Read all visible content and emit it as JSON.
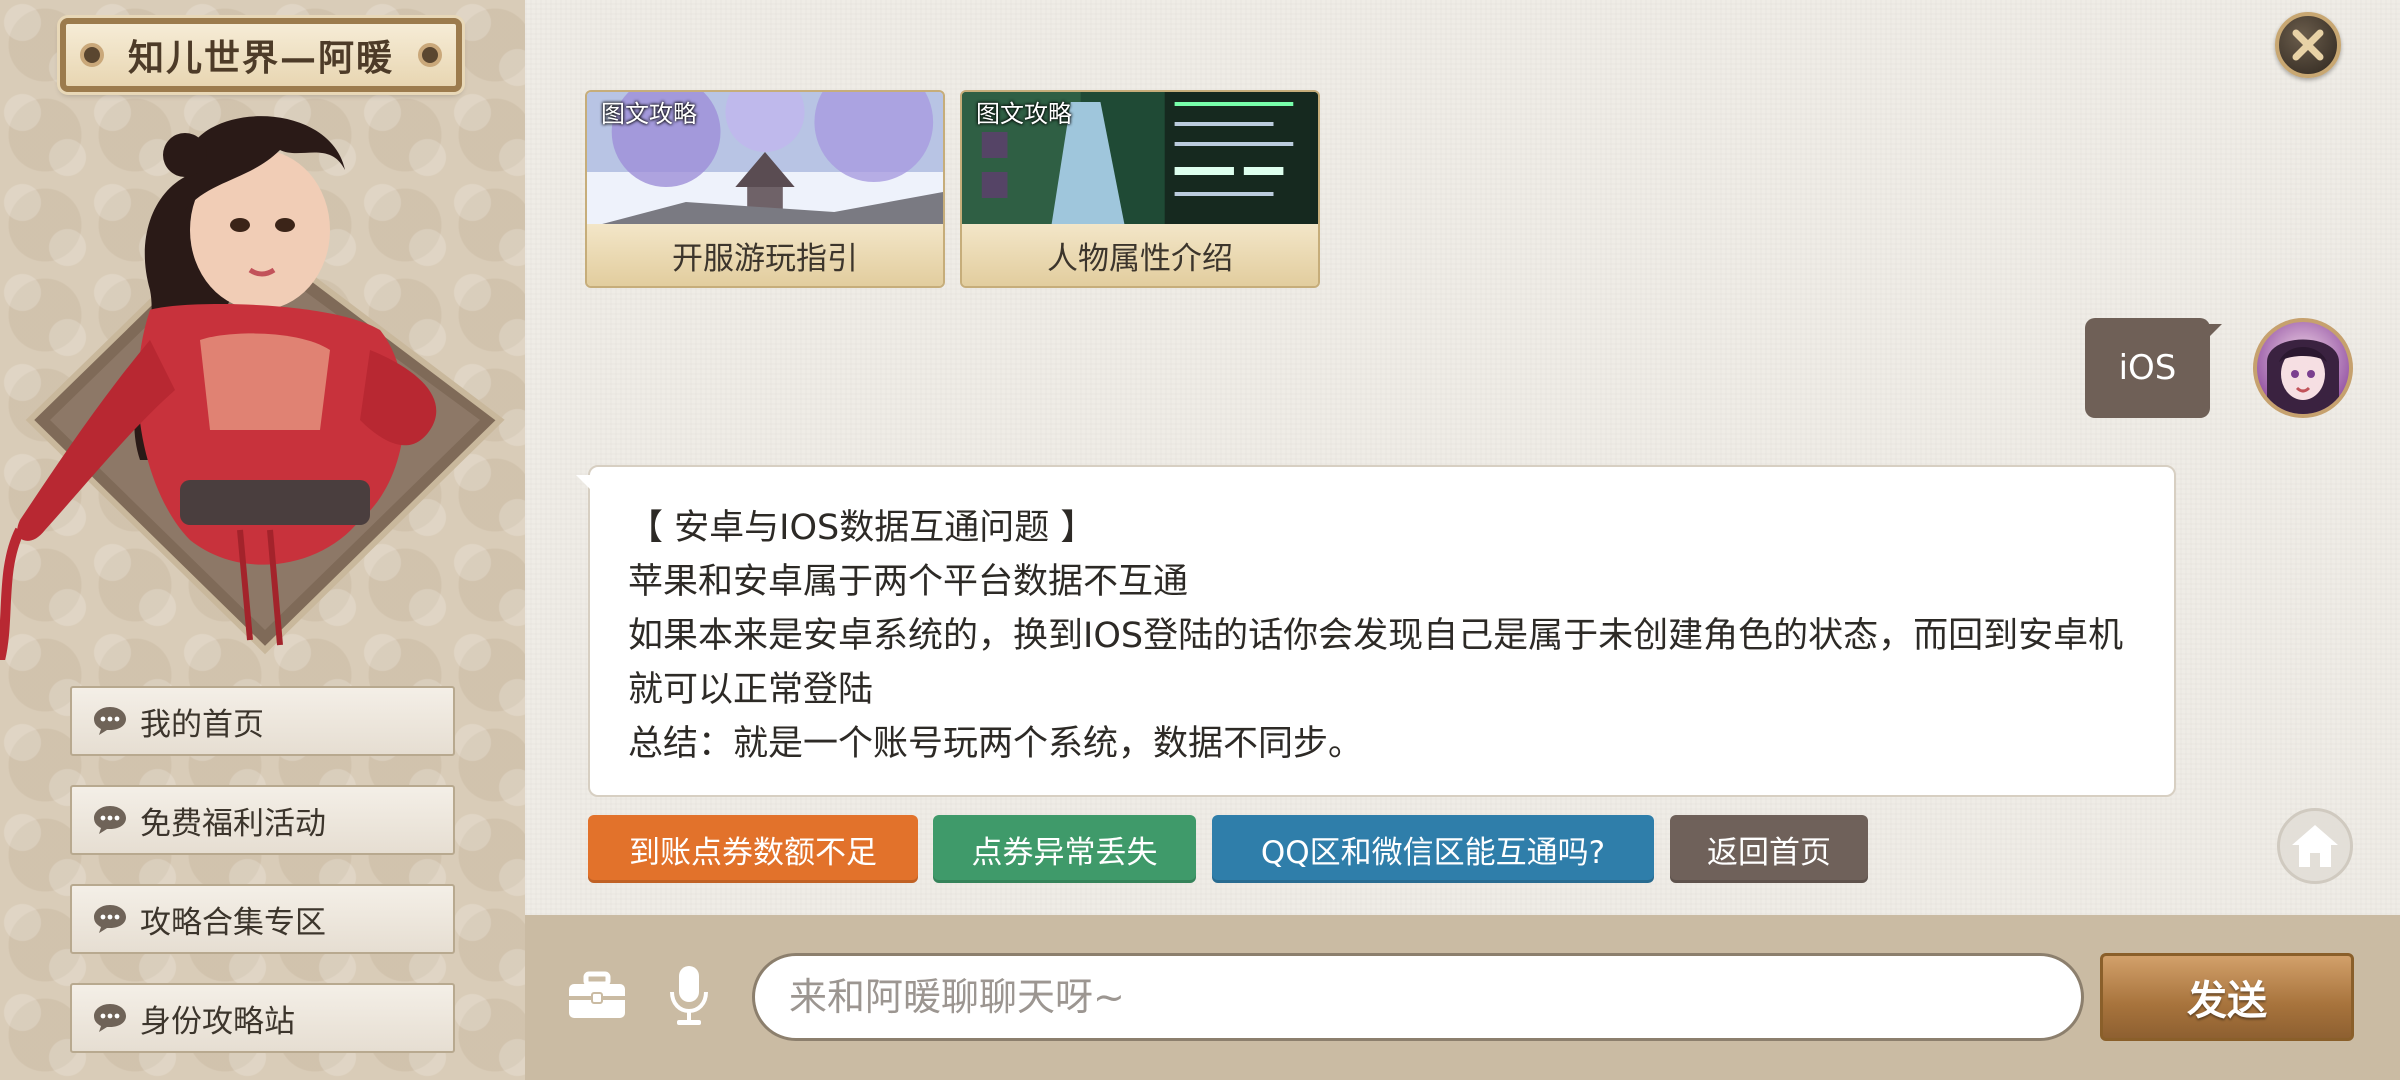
{
  "sidebar": {
    "title": "知儿世界—阿暖",
    "menu": [
      {
        "label": "我的首页"
      },
      {
        "label": "免费福利活动"
      },
      {
        "label": "攻略合集专区"
      },
      {
        "label": "身份攻略站"
      }
    ]
  },
  "guides": [
    {
      "badge": "图文攻略",
      "caption": "开服游玩指引"
    },
    {
      "badge": "图文攻略",
      "caption": "人物属性介绍"
    }
  ],
  "user_message": "iOS",
  "reply": {
    "lines": [
      "【 安卓与IOS数据互通问题 】",
      "苹果和安卓属于两个平台数据不互通",
      "如果本来是安卓系统的，换到IOS登陆的话你会发现自己是属于未创建角色的状态，而回到安卓机就可以正常登陆",
      "总结：就是一个账号玩两个系统，数据不同步。"
    ]
  },
  "quick_replies": [
    {
      "label": "到账点券数额不足",
      "color": "#e2722b"
    },
    {
      "label": "点券异常丢失",
      "color": "#3f9a6a"
    },
    {
      "label": "QQ区和微信区能互通吗?",
      "color": "#2f7eaa"
    },
    {
      "label": "返回首页",
      "color": "#6f615a"
    }
  ],
  "input": {
    "placeholder": "来和阿暖聊聊天呀~"
  },
  "send_label": "发送",
  "colors": {
    "accent_gold": "#a7733c",
    "panel": "#d9ccb8",
    "bubble_user": "#6f6057"
  }
}
